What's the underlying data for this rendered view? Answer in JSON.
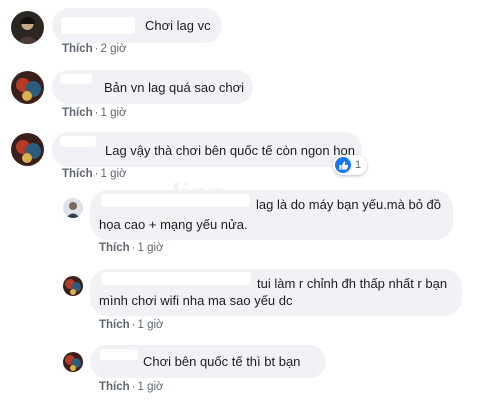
{
  "comments": [
    {
      "text": "Chơi lag vc",
      "like": "Thích",
      "time": "2 giờ",
      "avatar_icon": "user-avatar-icon"
    },
    {
      "text": "Bản vn lag quá sao chơi",
      "like": "Thích",
      "time": "1 giờ",
      "avatar_icon": "user-avatar-icon"
    },
    {
      "text": "Lag vậy thà chơi bên quốc tế còn ngon hon",
      "like": "Thích",
      "time": "1 giờ",
      "reaction_count": "1",
      "reaction_icon": "thumbs-up-icon",
      "avatar_icon": "user-avatar-icon"
    }
  ],
  "replies": [
    {
      "lines": [
        "lag là do máy bạn yếu.mà bỏ đồ",
        "họa cao + mạng yếu nửa."
      ],
      "like": "Thích",
      "time": "1 giờ",
      "avatar_icon": "user-avatar-icon"
    },
    {
      "lines": [
        "tui làm r chỉnh đh thấp nhất r bạn",
        "mình chơi wifi nha ma sao yếu dc"
      ],
      "like": "Thích",
      "time": "1 giờ",
      "avatar_icon": "user-avatar-icon"
    },
    {
      "text": "Chơi bên quốc tế thì bt bạn",
      "like": "Thích",
      "time": "1 giờ",
      "avatar_icon": "user-avatar-icon"
    }
  ],
  "colors": {
    "bubble": "#f0f2f5",
    "meta": "#606770",
    "like_badge": "#1877f2"
  }
}
